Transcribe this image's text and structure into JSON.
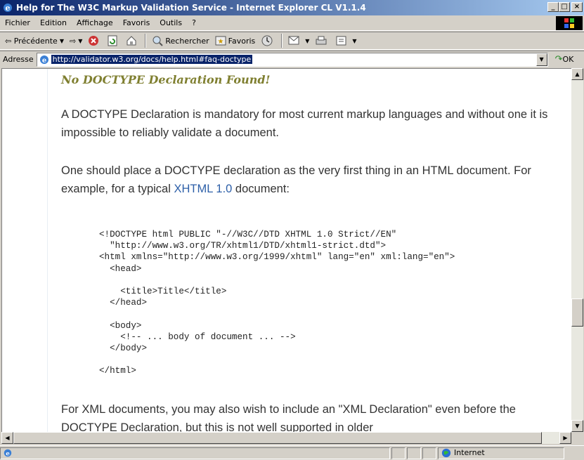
{
  "window": {
    "title": "Help for The W3C Markup Validation Service - Internet Explorer CL V1.1.4"
  },
  "menu": [
    "Fichier",
    "Edition",
    "Affichage",
    "Favoris",
    "Outils",
    "?"
  ],
  "toolbar": {
    "back": "Précédente",
    "search": "Rechercher",
    "favorites": "Favoris"
  },
  "address": {
    "label": "Adresse",
    "url": "http://validator.w3.org/docs/help.html#faq-doctype",
    "go": "OK"
  },
  "page": {
    "heading": "No DOCTYPE Declaration Found!",
    "p1": "A DOCTYPE Declaration is mandatory for most current markup languages and without one it is impossible to reliably validate a document.",
    "p2_before": "One should place a DOCTYPE declaration as the very first thing in an HTML document. For example, for a typical ",
    "p2_link": "XHTML 1.0",
    "p2_after": " document:",
    "code": "<!DOCTYPE html PUBLIC \"-//W3C//DTD XHTML 1.0 Strict//EN\"\n  \"http://www.w3.org/TR/xhtml1/DTD/xhtml1-strict.dtd\">\n<html xmlns=\"http://www.w3.org/1999/xhtml\" lang=\"en\" xml:lang=\"en\">\n  <head>\n\n    <title>Title</title>\n  </head>\n\n  <body>\n    <!-- ... body of document ... -->\n  </body>\n\n</html>",
    "p3": "For XML documents, you may also wish to include an \"XML Declaration\" even before the DOCTYPE Declaration, but this is not well supported in older"
  },
  "status": {
    "zone": "Internet"
  },
  "colors": {
    "titlebar": "#0a246a",
    "heading": "#7f7f30",
    "link": "#2d5fa8"
  }
}
